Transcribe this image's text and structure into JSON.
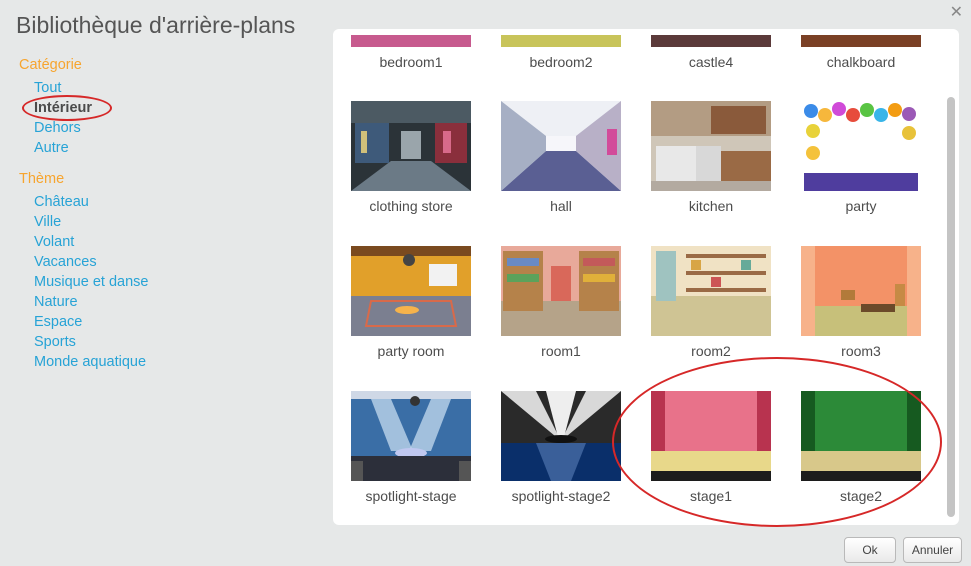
{
  "dialog": {
    "title": "Bibliothèque d'arrière-plans"
  },
  "sidebar": {
    "category_heading": "Catégorie",
    "categories": [
      "Tout",
      "Intérieur",
      "Dehors",
      "Autre"
    ],
    "selected_category": "Intérieur",
    "theme_heading": "Thème",
    "themes": [
      "Château",
      "Ville",
      "Volant",
      "Vacances",
      "Musique et danse",
      "Nature",
      "Espace",
      "Sports",
      "Monde aquatique"
    ]
  },
  "backdrops": [
    {
      "name": "bedroom1"
    },
    {
      "name": "bedroom2"
    },
    {
      "name": "castle4"
    },
    {
      "name": "chalkboard"
    },
    {
      "name": "clothing store"
    },
    {
      "name": "hall"
    },
    {
      "name": "kitchen"
    },
    {
      "name": "party"
    },
    {
      "name": "party room"
    },
    {
      "name": "room1"
    },
    {
      "name": "room2"
    },
    {
      "name": "room3"
    },
    {
      "name": "spotlight-stage"
    },
    {
      "name": "spotlight-stage2"
    },
    {
      "name": "stage1"
    },
    {
      "name": "stage2"
    }
  ],
  "buttons": {
    "ok": "Ok",
    "cancel": "Annuler"
  },
  "colors": {
    "accent_orange": "#f7a52f",
    "link_blue": "#27a3d6",
    "annotation_red": "#d62828"
  }
}
